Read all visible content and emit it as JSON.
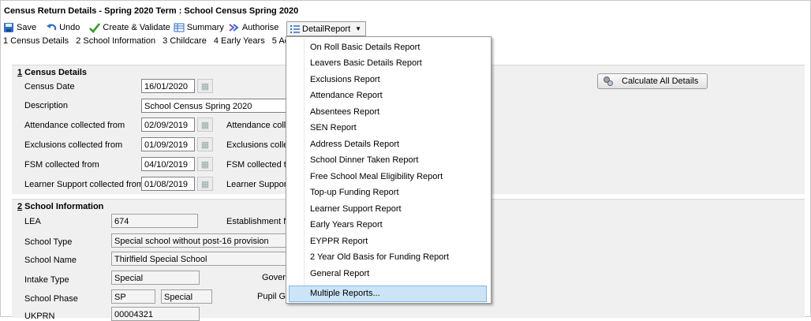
{
  "window": {
    "title": "Census Return Details - Spring 2020 Term : School Census Spring 2020"
  },
  "toolbar": {
    "save": "Save",
    "undo": "Undo",
    "create_validate": "Create & Validate",
    "summary": "Summary",
    "authorise": "Authorise",
    "detail_report": "DetailReport"
  },
  "tabs": [
    "1 Census Details",
    "2 School Information",
    "3 Childcare",
    "4 Early Years",
    "5 Ad"
  ],
  "census_details": {
    "section_num": "1",
    "section_rest": " Census Details",
    "census_date_label": "Census Date",
    "census_date": "16/01/2020",
    "description_label": "Description",
    "description": "School Census Spring 2020",
    "attendance_from_label": "Attendance collected from",
    "attendance_from": "02/09/2019",
    "attendance_to_label": "Attendance colle",
    "exclusions_from_label": "Exclusions collected from",
    "exclusions_from": "01/09/2019",
    "exclusions_to_label": "Exclusions colle",
    "fsm_from_label": "FSM collected from",
    "fsm_from": "04/10/2019",
    "fsm_to_label": "FSM collected to",
    "learner_support_from_label": "Learner Support collected from",
    "learner_support_from": "01/08/2019",
    "learner_support_to_label": "Learner Support",
    "calculate_button": "Calculate All Details"
  },
  "school_information": {
    "section_num": "2",
    "section_rest": " School Information",
    "lea_label": "LEA",
    "lea": "674",
    "establishment_label": "Establishment N",
    "school_type_label": "School Type",
    "school_type": "Special school without post-16 provision",
    "school_name_label": "School Name",
    "school_name": "Thirlfield Special School",
    "intake_type_label": "Intake Type",
    "intake_type": "Special",
    "gov_label": "Gover",
    "school_phase_label": "School Phase",
    "school_phase_code": "SP",
    "school_phase": "Special",
    "pupil_label": "Pupil Ge",
    "ukprn_label": "UKPRN",
    "ukprn": "00004321"
  },
  "report_menu": {
    "items": [
      "On Roll Basic Details Report",
      "Leavers Basic Details Report",
      "Exclusions Report",
      "Attendance Report",
      "Absentees Report",
      "SEN Report",
      "Address Details Report",
      "School Dinner Taken Report",
      "Free School Meal Eligibility Report",
      "Top-up Funding Report",
      "Learner Support Report",
      "Early Years Report",
      "EYPPR Report",
      "2 Year Old Basis for Funding Report",
      "General Report",
      "Multiple Reports..."
    ],
    "highlighted": "Multiple Reports..."
  }
}
